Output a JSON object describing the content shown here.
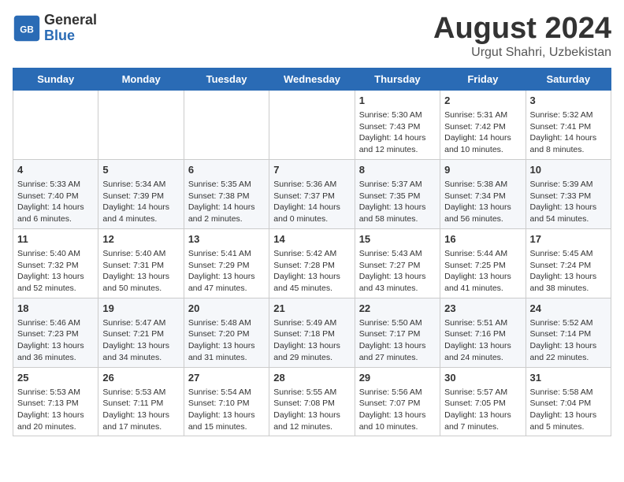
{
  "header": {
    "logo_line1": "General",
    "logo_line2": "Blue",
    "main_title": "August 2024",
    "subtitle": "Urgut Shahri, Uzbekistan"
  },
  "days_of_week": [
    "Sunday",
    "Monday",
    "Tuesday",
    "Wednesday",
    "Thursday",
    "Friday",
    "Saturday"
  ],
  "weeks": [
    [
      {
        "day": "",
        "content": ""
      },
      {
        "day": "",
        "content": ""
      },
      {
        "day": "",
        "content": ""
      },
      {
        "day": "",
        "content": ""
      },
      {
        "day": "1",
        "content": "Sunrise: 5:30 AM\nSunset: 7:43 PM\nDaylight: 14 hours\nand 12 minutes."
      },
      {
        "day": "2",
        "content": "Sunrise: 5:31 AM\nSunset: 7:42 PM\nDaylight: 14 hours\nand 10 minutes."
      },
      {
        "day": "3",
        "content": "Sunrise: 5:32 AM\nSunset: 7:41 PM\nDaylight: 14 hours\nand 8 minutes."
      }
    ],
    [
      {
        "day": "4",
        "content": "Sunrise: 5:33 AM\nSunset: 7:40 PM\nDaylight: 14 hours\nand 6 minutes."
      },
      {
        "day": "5",
        "content": "Sunrise: 5:34 AM\nSunset: 7:39 PM\nDaylight: 14 hours\nand 4 minutes."
      },
      {
        "day": "6",
        "content": "Sunrise: 5:35 AM\nSunset: 7:38 PM\nDaylight: 14 hours\nand 2 minutes."
      },
      {
        "day": "7",
        "content": "Sunrise: 5:36 AM\nSunset: 7:37 PM\nDaylight: 14 hours\nand 0 minutes."
      },
      {
        "day": "8",
        "content": "Sunrise: 5:37 AM\nSunset: 7:35 PM\nDaylight: 13 hours\nand 58 minutes."
      },
      {
        "day": "9",
        "content": "Sunrise: 5:38 AM\nSunset: 7:34 PM\nDaylight: 13 hours\nand 56 minutes."
      },
      {
        "day": "10",
        "content": "Sunrise: 5:39 AM\nSunset: 7:33 PM\nDaylight: 13 hours\nand 54 minutes."
      }
    ],
    [
      {
        "day": "11",
        "content": "Sunrise: 5:40 AM\nSunset: 7:32 PM\nDaylight: 13 hours\nand 52 minutes."
      },
      {
        "day": "12",
        "content": "Sunrise: 5:40 AM\nSunset: 7:31 PM\nDaylight: 13 hours\nand 50 minutes."
      },
      {
        "day": "13",
        "content": "Sunrise: 5:41 AM\nSunset: 7:29 PM\nDaylight: 13 hours\nand 47 minutes."
      },
      {
        "day": "14",
        "content": "Sunrise: 5:42 AM\nSunset: 7:28 PM\nDaylight: 13 hours\nand 45 minutes."
      },
      {
        "day": "15",
        "content": "Sunrise: 5:43 AM\nSunset: 7:27 PM\nDaylight: 13 hours\nand 43 minutes."
      },
      {
        "day": "16",
        "content": "Sunrise: 5:44 AM\nSunset: 7:25 PM\nDaylight: 13 hours\nand 41 minutes."
      },
      {
        "day": "17",
        "content": "Sunrise: 5:45 AM\nSunset: 7:24 PM\nDaylight: 13 hours\nand 38 minutes."
      }
    ],
    [
      {
        "day": "18",
        "content": "Sunrise: 5:46 AM\nSunset: 7:23 PM\nDaylight: 13 hours\nand 36 minutes."
      },
      {
        "day": "19",
        "content": "Sunrise: 5:47 AM\nSunset: 7:21 PM\nDaylight: 13 hours\nand 34 minutes."
      },
      {
        "day": "20",
        "content": "Sunrise: 5:48 AM\nSunset: 7:20 PM\nDaylight: 13 hours\nand 31 minutes."
      },
      {
        "day": "21",
        "content": "Sunrise: 5:49 AM\nSunset: 7:18 PM\nDaylight: 13 hours\nand 29 minutes."
      },
      {
        "day": "22",
        "content": "Sunrise: 5:50 AM\nSunset: 7:17 PM\nDaylight: 13 hours\nand 27 minutes."
      },
      {
        "day": "23",
        "content": "Sunrise: 5:51 AM\nSunset: 7:16 PM\nDaylight: 13 hours\nand 24 minutes."
      },
      {
        "day": "24",
        "content": "Sunrise: 5:52 AM\nSunset: 7:14 PM\nDaylight: 13 hours\nand 22 minutes."
      }
    ],
    [
      {
        "day": "25",
        "content": "Sunrise: 5:53 AM\nSunset: 7:13 PM\nDaylight: 13 hours\nand 20 minutes."
      },
      {
        "day": "26",
        "content": "Sunrise: 5:53 AM\nSunset: 7:11 PM\nDaylight: 13 hours\nand 17 minutes."
      },
      {
        "day": "27",
        "content": "Sunrise: 5:54 AM\nSunset: 7:10 PM\nDaylight: 13 hours\nand 15 minutes."
      },
      {
        "day": "28",
        "content": "Sunrise: 5:55 AM\nSunset: 7:08 PM\nDaylight: 13 hours\nand 12 minutes."
      },
      {
        "day": "29",
        "content": "Sunrise: 5:56 AM\nSunset: 7:07 PM\nDaylight: 13 hours\nand 10 minutes."
      },
      {
        "day": "30",
        "content": "Sunrise: 5:57 AM\nSunset: 7:05 PM\nDaylight: 13 hours\nand 7 minutes."
      },
      {
        "day": "31",
        "content": "Sunrise: 5:58 AM\nSunset: 7:04 PM\nDaylight: 13 hours\nand 5 minutes."
      }
    ]
  ]
}
